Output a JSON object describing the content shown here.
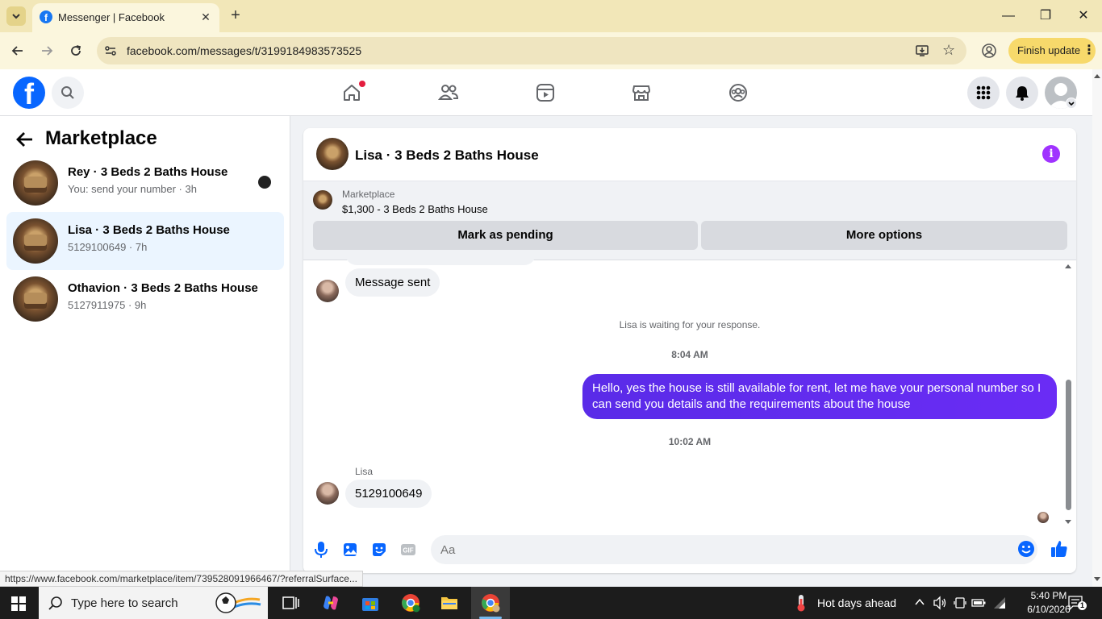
{
  "browser": {
    "tab_title": "Messenger | Facebook",
    "url": "facebook.com/messages/t/3199184983573525",
    "finish_update_label": "Finish update",
    "status_url": "https://www.facebook.com/marketplace/item/739528091966467/?referralSurface..."
  },
  "sidebar": {
    "title": "Marketplace",
    "conversations": [
      {
        "name": "Rey · 3 Beds 2 Baths House",
        "subtitle": "You: send your number · 3h",
        "active": false
      },
      {
        "name": "Lisa · 3 Beds 2 Baths House",
        "subtitle": "5129100649 · 7h",
        "active": true
      },
      {
        "name": "Othavion · 3 Beds 2 Baths House",
        "subtitle": "5127911975 · 9h",
        "active": false
      }
    ]
  },
  "chat": {
    "title": "Lisa · 3 Beds 2 Baths House",
    "listing": {
      "label": "Marketplace",
      "price_title": "$1,300 - 3 Beds 2 Baths House",
      "mark_pending_label": "Mark as pending",
      "more_options_label": "More options"
    },
    "messages": {
      "msg1": "Message sent",
      "waiting": "Lisa is waiting for your response.",
      "time1": "8:04 AM",
      "outgoing": "Hello, yes the house is still available for rent, let me have your personal number so I can send you details and the requirements about the house",
      "time2": "10:02 AM",
      "sender": "Lisa",
      "msg2": "5129100649"
    },
    "composer_placeholder": "Aa"
  },
  "taskbar": {
    "search_placeholder": "Type here to search",
    "weather": "Hot days ahead",
    "time": "5:40 PM",
    "date": "6/10/2026",
    "notification_count": "1"
  },
  "colors": {
    "fb_blue": "#0866ff",
    "outgoing_bubble": "#5b2ef0",
    "info_icon": "#a033ff",
    "active_conversation": "#ebf5ff"
  }
}
